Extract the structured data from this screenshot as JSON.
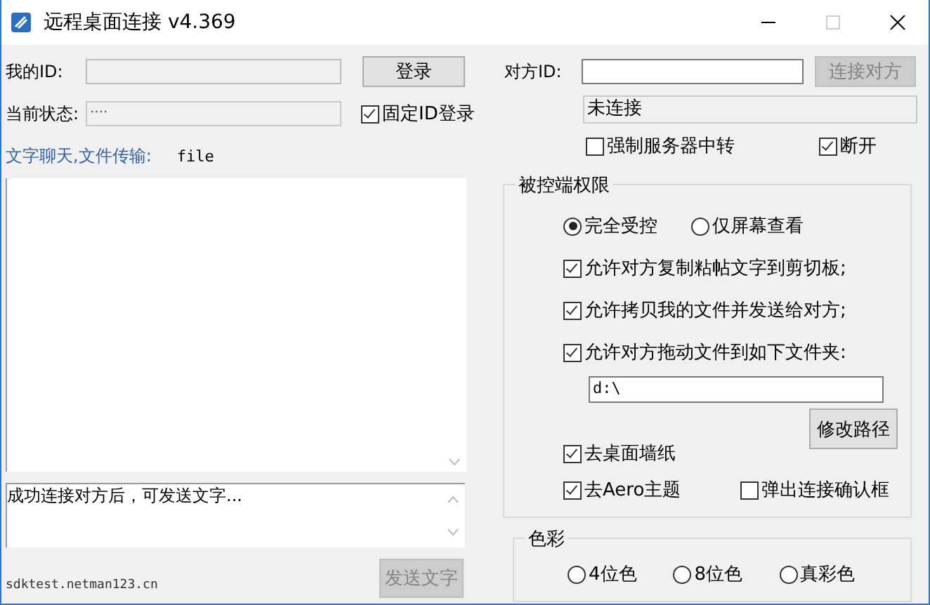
{
  "window": {
    "title": "远程桌面连接 v4.369"
  },
  "left": {
    "my_id_label": "我的ID:",
    "login_button": "登录",
    "status_label": "当前状态:",
    "status_value": "····",
    "fixed_id": {
      "label": "固定ID登录",
      "checked": true
    },
    "chat_label": "文字聊天,文件传输:",
    "file_label": "file",
    "message": "成功连接对方后，可发送文字...",
    "server": "sdktest.netman123.cn",
    "send_button": {
      "label": "发送文字",
      "disabled": true
    }
  },
  "right": {
    "peer_id_label": "对方ID:",
    "connect_button": {
      "label": "连接对方",
      "disabled": true
    },
    "connection_status": "未连接",
    "force_relay": {
      "label": "强制服务器中转",
      "checked": false
    },
    "disconnect": {
      "label": "断开",
      "checked": true
    }
  },
  "permissions": {
    "title": "被控端权限",
    "modes": [
      {
        "label": "完全受控",
        "selected": true
      },
      {
        "label": "仅屏幕查看",
        "selected": false
      }
    ],
    "allow_options": [
      {
        "label": "允许对方复制粘帖文字到剪切板;",
        "checked": true
      },
      {
        "label": "允许拷贝我的文件并发送给对方;",
        "checked": true
      },
      {
        "label": "允许对方拖动文件到如下文件夹:",
        "checked": true
      }
    ],
    "folder": "d:\\",
    "change_path_button": "修改路径",
    "display_options": [
      {
        "label": "去桌面墙纸",
        "checked": true
      },
      {
        "label": "去Aero主题",
        "checked": true
      },
      {
        "label": "弹出连接确认框",
        "checked": false
      }
    ]
  },
  "colors": {
    "title": "色彩",
    "depths": [
      {
        "label": "4位色",
        "selected": false
      },
      {
        "label": "8位色",
        "selected": false
      },
      {
        "label": "真彩色",
        "selected": false
      }
    ]
  }
}
